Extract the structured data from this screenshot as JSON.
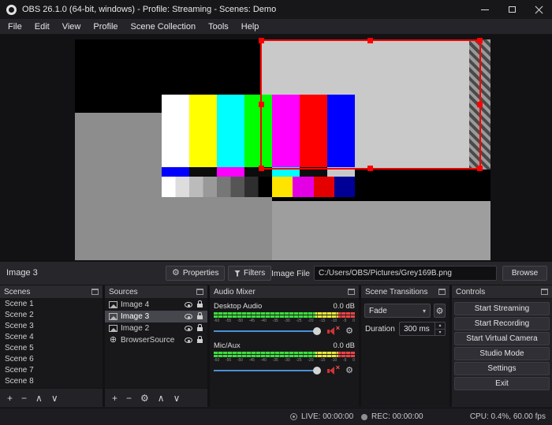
{
  "window": {
    "title": "OBS 26.1.0 (64-bit, windows) - Profile: Streaming - Scenes: Demo",
    "menu": [
      "File",
      "Edit",
      "View",
      "Profile",
      "Scene Collection",
      "Tools",
      "Help"
    ]
  },
  "icons": {
    "gear": "⚙",
    "plus": "+",
    "minus": "−",
    "up": "∧",
    "down": "∨",
    "arrow_up": "▴",
    "arrow_down": "▾",
    "globe": "⊕",
    "cross": "×"
  },
  "colors": {
    "selection_red": "#ff0000",
    "slider_blue": "#4a90d9",
    "mute_red": "#cf3434"
  },
  "properties_bar": {
    "selected_source": "Image 3",
    "properties": "Properties",
    "filters": "Filters",
    "image_file": "Image File",
    "path": "C:/Users/OBS/Pictures/Grey169B.png",
    "browse": "Browse"
  },
  "scenes": {
    "title": "Scenes",
    "items": [
      "Scene 1",
      "Scene 2",
      "Scene 3",
      "Scene 4",
      "Scene 5",
      "Scene 6",
      "Scene 7",
      "Scene 8"
    ]
  },
  "sources": {
    "title": "Sources",
    "items": [
      {
        "name": "Image 4"
      },
      {
        "name": "Image 3"
      },
      {
        "name": "Image 2"
      },
      {
        "name": "BrowserSource"
      }
    ]
  },
  "mixer": {
    "title": "Audio Mixer",
    "channels": [
      {
        "name": "Desktop Audio",
        "level": "0.0 dB"
      },
      {
        "name": "Mic/Aux",
        "level": "0.0 dB"
      }
    ],
    "scale": [
      "-60",
      "-55",
      "-50",
      "-45",
      "-40",
      "-35",
      "-30",
      "-25",
      "-20",
      "-15",
      "-10",
      "-5",
      "0"
    ]
  },
  "transitions": {
    "title": "Scene Transitions",
    "current": "Fade",
    "duration_label": "Duration",
    "duration": "300 ms"
  },
  "controls": {
    "title": "Controls",
    "buttons": [
      "Start Streaming",
      "Start Recording",
      "Start Virtual Camera",
      "Studio Mode",
      "Settings",
      "Exit"
    ]
  },
  "status": {
    "live": "LIVE: 00:00:00",
    "rec": "REC: 00:00:00",
    "cpu": "CPU: 0.4%, 60.00 fps"
  }
}
